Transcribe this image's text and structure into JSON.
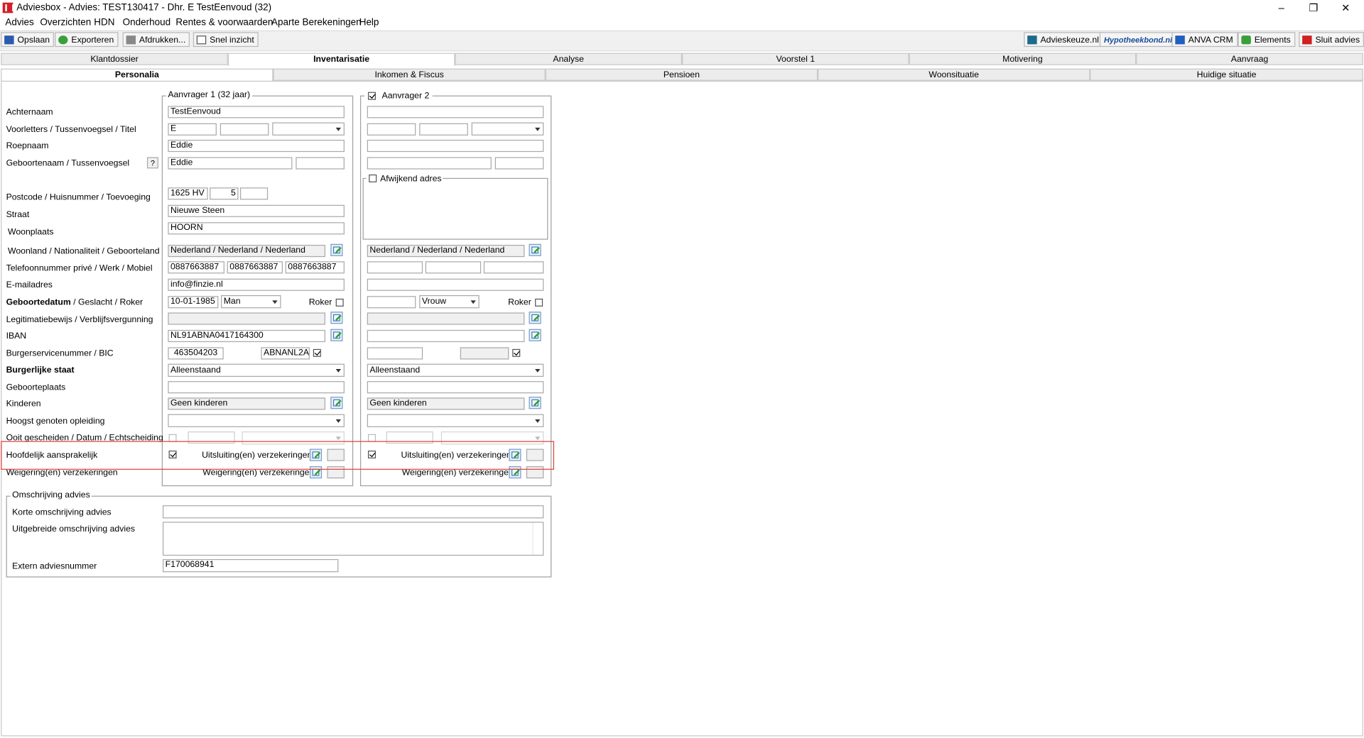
{
  "window": {
    "title": "Adviesbox - Advies: TEST130417 - Dhr. E TestEenvoud (32)",
    "minimize": "–",
    "restore": "❐",
    "close": "✕"
  },
  "menu": [
    "Advies",
    "Overzichten",
    "HDN",
    "Onderhoud",
    "Rentes & voorwaarden",
    "Aparte Berekeningen",
    "Help"
  ],
  "toolbar": {
    "left": [
      {
        "label": "Opslaan",
        "icon": "save-icon"
      },
      {
        "label": "Exporteren",
        "icon": "export-icon"
      },
      {
        "label": "Afdrukken...",
        "icon": "print-icon"
      },
      {
        "label": "Snel inzicht",
        "icon": "document-icon"
      }
    ],
    "right": [
      {
        "label": "Advieskeuze.nl",
        "icon": "advieskeuze-icon"
      },
      {
        "label": "Hypotheekbond.nl",
        "icon": "hypotheekbond-logo"
      },
      {
        "label": "ANVA CRM",
        "icon": "anva-icon"
      },
      {
        "label": "Elements",
        "icon": "elements-icon"
      },
      {
        "label": "Sluit advies",
        "icon": "close-red-icon"
      }
    ]
  },
  "main_tabs": [
    "Klantdossier",
    "Inventarisatie",
    "Analyse",
    "Voorstel 1",
    "Motivering",
    "Aanvraag"
  ],
  "main_tab_active": "Inventarisatie",
  "sub_tabs": [
    "Personalia",
    "Inkomen & Fiscus",
    "Pensioen",
    "Woonsituatie",
    "Huidige situatie"
  ],
  "sub_tab_active": "Personalia",
  "labels": {
    "achternaam": "Achternaam",
    "voorletters": "Voorletters / Tussenvoegsel / Titel",
    "roepnaam": "Roepnaam",
    "geboortenaam": "Geboortenaam / Tussenvoegsel",
    "geboortenaam_help": "?",
    "postcode": "Postcode / Huisnummer / Toevoeging",
    "straat": "Straat",
    "woonplaats": "Woonplaats",
    "woonland": "Woonland / Nationaliteit / Geboorteland",
    "telefoon": "Telefoonnummer privé / Werk / Mobiel",
    "email": "E-mailadres",
    "geboortedatum_bold": "Geboortedatum",
    "geboortedatum_rest": " / Geslacht / Roker",
    "legitimatie": "Legitimatiebewijs / Verblijfsvergunning",
    "iban": "IBAN",
    "bsn": "Burgerservicenummer / BIC",
    "burgerlijke_staat": "Burgerlijke staat",
    "geboorteplaats": "Geboorteplaats",
    "kinderen": "Kinderen",
    "opleiding": "Hoogst genoten opleiding",
    "gescheiden": "Ooit gescheiden / Datum / Echtscheiding",
    "hoofdelijk": "Hoofdelijk aansprakelijk",
    "weigering": "Weigering(en) verzekeringen"
  },
  "aanvrager1": {
    "group_label": "Aanvrager 1 (32 jaar)",
    "achternaam": "TestEenvoud",
    "voorletters": "E",
    "tussenvoegsel": "",
    "titel": "",
    "roepnaam": "Eddie",
    "geboortenaam": "Eddie",
    "geboortenaam_tussenvoegsel": "",
    "postcode": "1625 HV",
    "huisnummer": "5",
    "toevoeging": "",
    "straat": "Nieuwe Steen",
    "woonplaats": "HOORN",
    "woonland": "Nederland / Nederland / Nederland",
    "tel_prive": "0887663887",
    "tel_werk": "0887663887",
    "tel_mobiel": "0887663887",
    "email": "info@finzie.nl",
    "geboortedatum": "10-01-1985",
    "geslacht": "Man",
    "roker_label": "Roker",
    "roker": false,
    "legitimatie": "",
    "iban": "NL91ABNA0417164300",
    "bsn": "463504203",
    "bic": "ABNANL2A",
    "bic_checked": true,
    "burgerlijke_staat": "Alleenstaand",
    "geboorteplaats": "",
    "kinderen": "Geen kinderen",
    "opleiding": "",
    "gescheiden": false,
    "gescheiden_datum": "",
    "echtscheiding": "",
    "hoofdelijk": true,
    "uitsluiting_label": "Uitsluiting(en) verzekeringen",
    "weigering_label": "Weigering(en) verzekeringen"
  },
  "aanvrager2": {
    "group_label": "Aanvrager 2",
    "enabled": true,
    "afwijkend_adres": "Afwijkend adres",
    "afwijkend_checked": false,
    "woonland": "Nederland / Nederland / Nederland",
    "geslacht": "Vrouw",
    "roker_label": "Roker",
    "roker": false,
    "bic_checked": true,
    "burgerlijke_staat": "Alleenstaand",
    "kinderen": "Geen kinderen",
    "hoofdelijk": true,
    "uitsluiting_label": "Uitsluiting(en) verzekeringen",
    "weigering_label": "Weigering(en) verzekeringen"
  },
  "omschrijving": {
    "group_label": "Omschrijving advies",
    "korte_label": "Korte omschrijving advies",
    "korte": "",
    "uitgebreide_label": "Uitgebreide omschrijving advies",
    "uitgebreide": "",
    "extern_label": "Extern adviesnummer",
    "extern": "F170068941"
  },
  "colors": {
    "highlight": "#e04040",
    "accent": "#d0202a"
  }
}
